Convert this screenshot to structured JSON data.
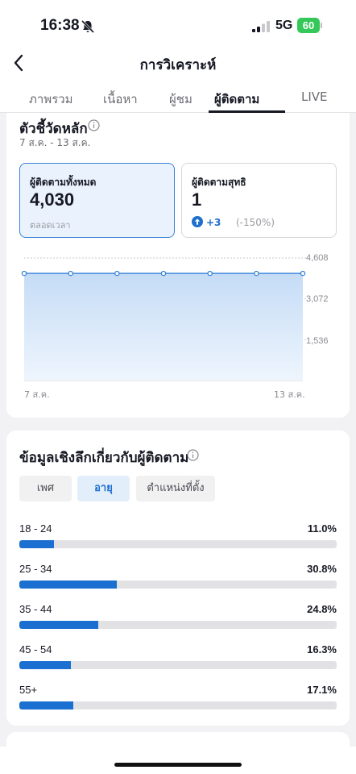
{
  "status_bar": {
    "time": "16:38",
    "network": "5G",
    "battery": "60"
  },
  "header": {
    "title": "การวิเคราะห์",
    "tabs": [
      {
        "label": "ภาพรวม"
      },
      {
        "label": "เนื้อหา"
      },
      {
        "label": "ผู้ชม"
      },
      {
        "label": "ผู้ติดตาม",
        "active": true
      },
      {
        "label": "LIVE"
      }
    ]
  },
  "key_metrics": {
    "title": "ตัวชี้วัดหลัก",
    "date_range": "7 ส.ค. - 13 ส.ค.",
    "cards": [
      {
        "label": "ผู้ติดตามทั้งหมด",
        "value": "4,030",
        "sub": "ตลอดเวลา",
        "selected": true
      },
      {
        "label": "ผู้ติดตามสุทธิ",
        "value": "1",
        "delta": "+3",
        "delta_pct": "(-150%)"
      }
    ]
  },
  "chart_data": {
    "type": "area",
    "y_ticks": [
      "4,608",
      "3,072",
      "1,536"
    ],
    "x_labels": [
      "7 ส.ค.",
      "13 ส.ค."
    ],
    "x": [
      "7 ส.ค.",
      "8 ส.ค.",
      "9 ส.ค.",
      "10 ส.ค.",
      "11 ส.ค.",
      "12 ส.ค.",
      "13 ส.ค."
    ],
    "values": [
      4030,
      4030,
      4030,
      4030,
      4030,
      4030,
      4030
    ],
    "ylim": [
      0,
      4608
    ],
    "color": "#2f7fd6"
  },
  "insights": {
    "title": "ข้อมูลเชิงลึกเกี่ยวกับผู้ติดตาม",
    "filters": [
      {
        "label": "เพศ"
      },
      {
        "label": "อายุ",
        "active": true
      },
      {
        "label": "ตำแหน่งที่ตั้ง"
      }
    ],
    "age_groups": [
      {
        "label": "18 - 24",
        "percent": "11.0%",
        "value": 11.0
      },
      {
        "label": "25 - 34",
        "percent": "30.8%",
        "value": 30.8
      },
      {
        "label": "35 - 44",
        "percent": "24.8%",
        "value": 24.8
      },
      {
        "label": "45 - 54",
        "percent": "16.3%",
        "value": 16.3
      },
      {
        "label": "55+",
        "percent": "17.1%",
        "value": 17.1
      }
    ]
  },
  "colors": {
    "accent": "#1a6fd0",
    "battery": "#34c759"
  }
}
